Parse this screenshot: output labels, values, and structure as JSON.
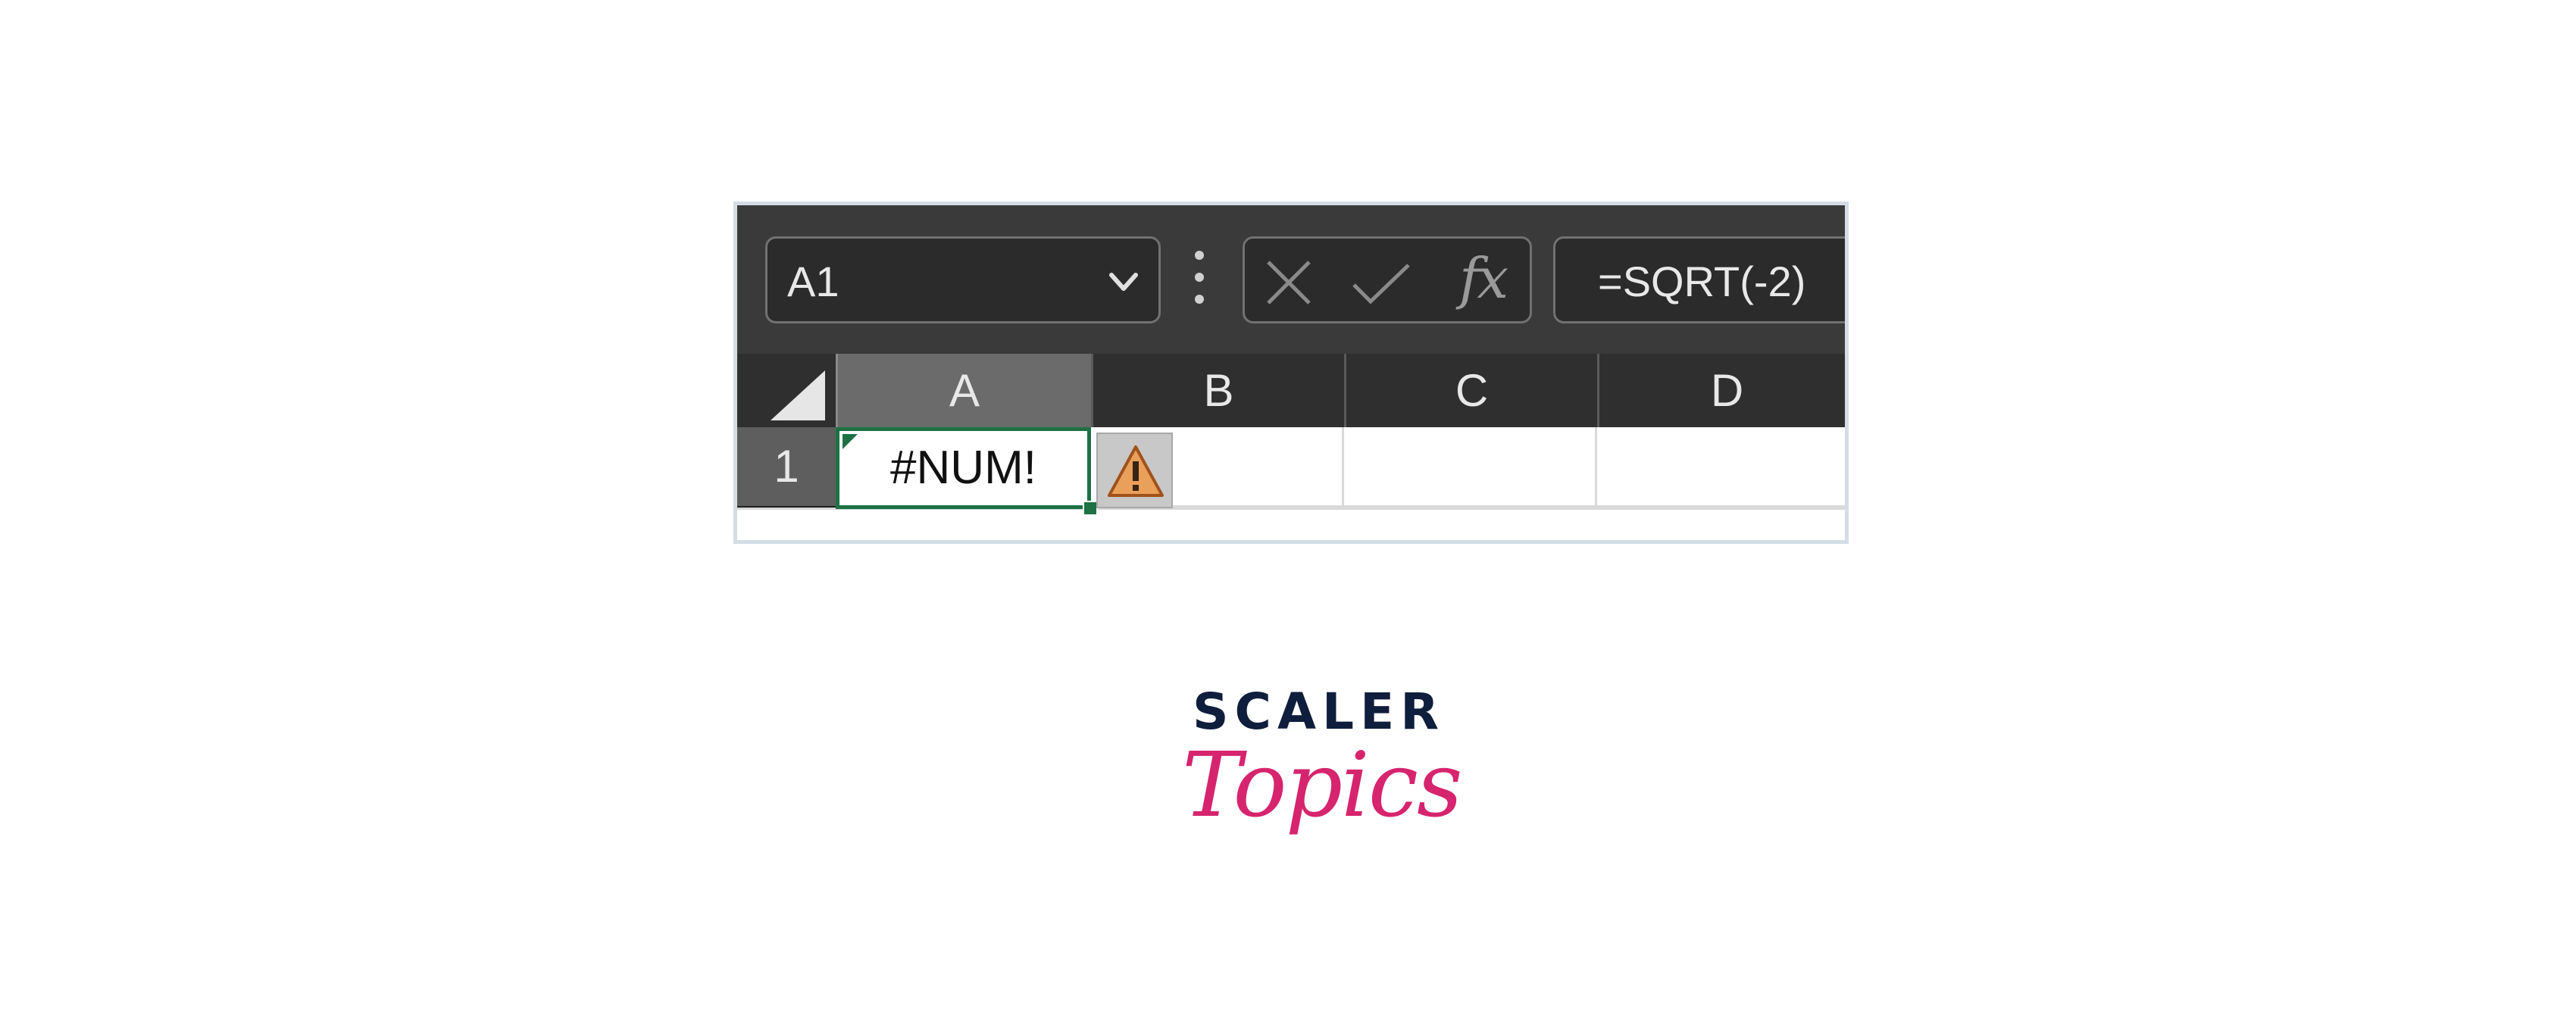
{
  "formula_bar": {
    "name_box": "A1",
    "formula": "=SQRT(-2)",
    "insert_function_label": "fx"
  },
  "columns": [
    "A",
    "B",
    "C",
    "D"
  ],
  "rows": [
    "1"
  ],
  "cells": {
    "A1": "#NUM!"
  },
  "logo": {
    "line1": "SCALER",
    "line2": "Topics"
  },
  "colors": {
    "selection_border": "#1e7145",
    "error_icon": "#c46b1c",
    "logo_navy": "#0f1e3c",
    "logo_pink": "#d6246e"
  },
  "icons": [
    "chevron-down-icon",
    "more-icon",
    "cancel-icon",
    "enter-icon",
    "warning-icon",
    "select-all-triangle-icon"
  ]
}
